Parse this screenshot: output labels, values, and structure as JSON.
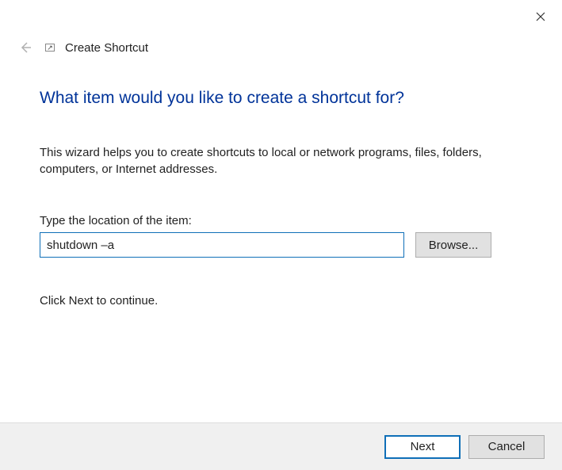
{
  "header": {
    "title": "Create Shortcut"
  },
  "main": {
    "heading": "What item would you like to create a shortcut for?",
    "description": "This wizard helps you to create shortcuts to local or network programs, files, folders, computers, or Internet addresses.",
    "field_label": "Type the location of the item:",
    "location_value": "shutdown –a",
    "browse_label": "Browse...",
    "continue_text": "Click Next to continue."
  },
  "footer": {
    "next_label": "Next",
    "cancel_label": "Cancel"
  }
}
